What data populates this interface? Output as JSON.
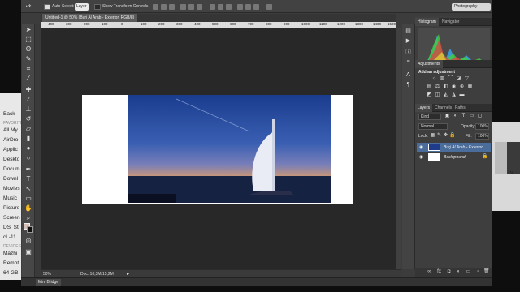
{
  "options_bar": {
    "auto_select_label": "Auto-Select:",
    "auto_select_value": "Layer",
    "transform_controls_label": "Show Transform Controls",
    "workspace": "Photography"
  },
  "document": {
    "tab_title": "Untitled-1 @ 50% (Burj Al Arab - Exterior, RGB/8)",
    "zoom": "50%",
    "doc_info": "Doc: 10,3M/15,2M"
  },
  "ruler_marks": [
    "400",
    "300",
    "200",
    "100",
    "0",
    "100",
    "200",
    "300",
    "400",
    "500",
    "600",
    "700",
    "800",
    "900",
    "1000",
    "1100",
    "1200",
    "1300",
    "1400",
    "1500"
  ],
  "mini_bridge": "Mini Bridge",
  "finder": {
    "items": [
      "Back",
      "FAVORITES",
      "All My",
      "AirDro",
      "Applic",
      "Deskto",
      "Docum",
      "Downl",
      "Movies",
      "Music",
      "Picture",
      "Screen",
      "DS_St",
      "cL-11",
      "DEVICES",
      "Mazhi",
      "Remot",
      "64 GB"
    ]
  },
  "right_window": {
    "label": "v"
  },
  "panels": {
    "top_tabs": [
      "Histogram",
      "Navigator"
    ],
    "adjustments_tab": "Adjustments",
    "add_adjustment": "Add an adjustment",
    "layers_tabs": [
      "Layers",
      "Channels",
      "Paths"
    ],
    "kind": "Kind",
    "blend_mode": "Normal",
    "opacity_label": "Opacity:",
    "opacity_value": "100%",
    "lock_label": "Lock:",
    "fill_label": "Fill:",
    "fill_value": "100%",
    "layers": [
      {
        "name": "Burj Al Arab - Exterior",
        "selected": true
      },
      {
        "name": "Background",
        "selected": false
      }
    ]
  },
  "colors": {
    "foreground": "#d6c0b9",
    "background": "#111111",
    "selection": "#4a6d9c"
  }
}
